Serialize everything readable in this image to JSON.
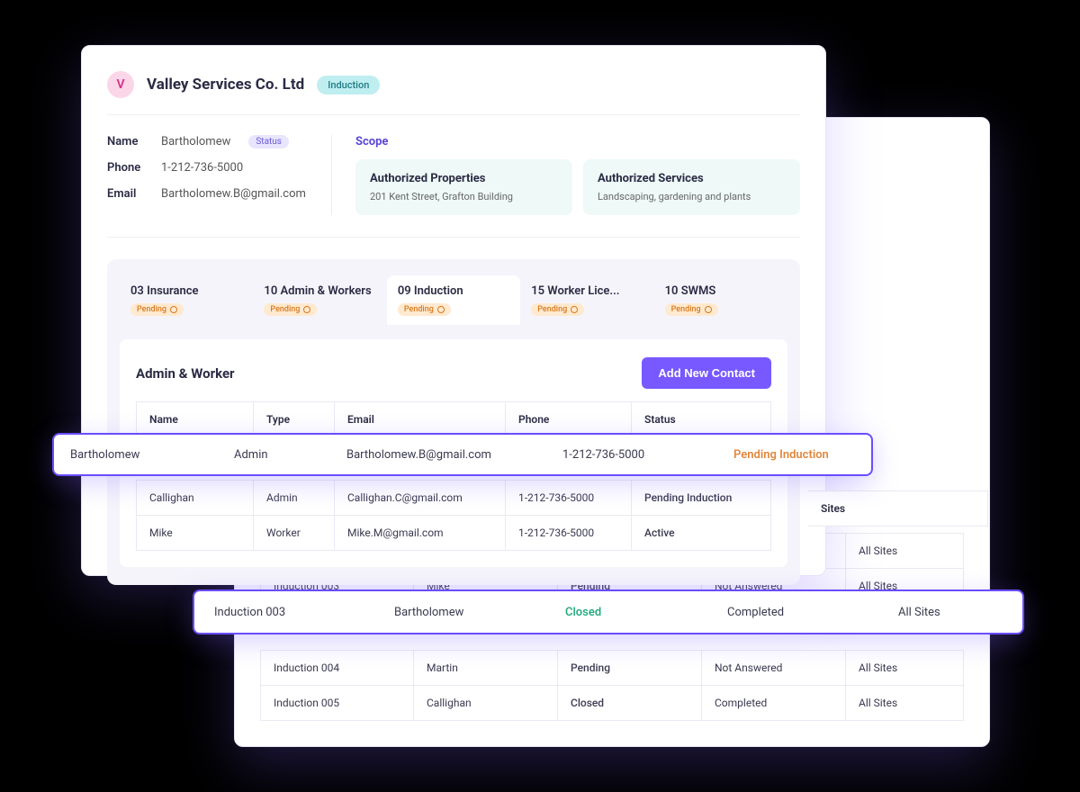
{
  "company": {
    "initial": "V",
    "name": "Valley Services Co. Ltd",
    "tag": "Induction"
  },
  "contact": {
    "labels": {
      "name": "Name",
      "phone": "Phone",
      "email": "Email"
    },
    "name": "Bartholomew",
    "status_pill": "Status",
    "phone": "1-212-736-5000",
    "email": "Bartholomew.B@gmail.com"
  },
  "scope": {
    "title": "Scope",
    "properties": {
      "heading": "Authorized Properties",
      "text": "201 Kent Street, Grafton Building"
    },
    "services": {
      "heading": "Authorized Services",
      "text": "Landscaping, gardening and plants"
    }
  },
  "tabs": {
    "items": [
      {
        "label": "03 Insurance",
        "chip": "Pending"
      },
      {
        "label": "10 Admin & Workers",
        "chip": "Pending"
      },
      {
        "label": "09 Induction",
        "chip": "Pending"
      },
      {
        "label": "15 Worker Lice...",
        "chip": "Pending"
      },
      {
        "label": "10 SWMS",
        "chip": "Pending"
      }
    ]
  },
  "panel": {
    "title": "Admin & Worker",
    "add_button": "Add New Contact",
    "headers": {
      "name": "Name",
      "type": "Type",
      "email": "Email",
      "phone": "Phone",
      "status": "Status"
    },
    "rows": [
      {
        "name": "Callighan",
        "type": "Admin",
        "email": "Callighan.C@gmail.com",
        "phone": "1-212-736-5000",
        "status": "Pending Induction",
        "status_kind": "pending"
      },
      {
        "name": "Mike",
        "type": "Worker",
        "email": "Mike.M@gmail.com",
        "phone": "1-212-736-5000",
        "status": "Active",
        "status_kind": "active"
      }
    ],
    "highlight": {
      "name": "Bartholomew",
      "type": "Admin",
      "email": "Bartholomew.B@gmail.com",
      "phone": "1-212-736-5000",
      "status": "Pending Induction"
    }
  },
  "induction": {
    "sites_header": "Sites",
    "rows": [
      {
        "ind": "",
        "name": "",
        "status": "",
        "answer": "",
        "sites": "All Sites"
      },
      {
        "ind": "Induction 003",
        "name": "Mike",
        "status": "Pending",
        "status_kind": "pending",
        "answer": "Not Answered",
        "sites": "All Sites"
      },
      {
        "ind": "Induction 004",
        "name": "Martin",
        "status": "Pending",
        "status_kind": "pending",
        "answer": "Not Answered",
        "sites": "All Sites"
      },
      {
        "ind": "Induction 005",
        "name": "Callighan",
        "status": "Closed",
        "status_kind": "closed",
        "answer": "Completed",
        "sites": "All Sites"
      }
    ],
    "highlight": {
      "ind": "Induction 003",
      "name": "Bartholomew",
      "status": "Closed",
      "answer": "Completed",
      "sites": "All Sites"
    }
  }
}
